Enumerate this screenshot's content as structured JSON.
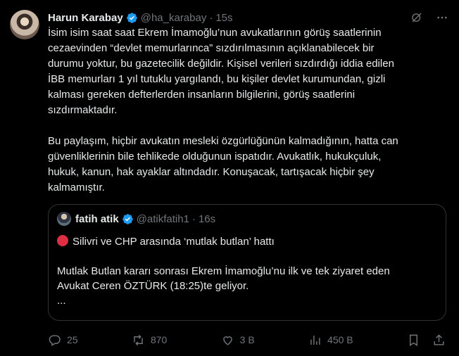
{
  "author": {
    "name": "Harun Karabay",
    "handle": "@ha_karabay",
    "time": "15s"
  },
  "body": "İsim isim saat saat Ekrem İmamoğlu’nun avukatlarının görüş saatlerinin\ncezaevinden “devlet memurlarınca” sızdırılmasının açıklanabilecek bir\ndurumu yoktur, bu gazetecilik değildir. Kişisel verileri sızdırdığı iddia edilen\nİBB memurları 1 yıl tutuklu yargılandı, bu kişiler devlet kurumundan, gizli\nkalması gereken defterlerden insanların bilgilerini, görüş saatlerini\nsızdırmaktadır.\n\nBu paylaşım, hiçbir avukatın mesleki özgürlüğünün kalmadığının, hatta can\ngüvenliklerinin bile tehlikede olduğunun ispatıdır. Avukatlık, hukukçuluk,\nhukuk, kanun, hak ayaklar altındadır. Konuşacak, tartışacak hiçbir şey\nkalmamıştır.",
  "quote": {
    "name": "fatih atik",
    "handle": "@atikfatih1",
    "time": "16s",
    "line1": "Silivri ve CHP arasında ‘mutlak butlan’ hattı",
    "line2": "Mutlak Butlan kararı sonrası Ekrem İmamoğlu’nu ilk ve tek ziyaret eden\nAvukat Ceren ÖZTÜRK (18:25)te geliyor.\n..."
  },
  "actions": {
    "replies": "25",
    "reposts": "870",
    "likes": "3 B",
    "views": "450 B"
  },
  "icons": {
    "verified": "verified-badge-icon",
    "grok": "grok-icon",
    "more": "more-icon",
    "reply": "reply-icon",
    "repost": "repost-icon",
    "like": "heart-icon",
    "views": "views-icon",
    "bookmark": "bookmark-icon",
    "share": "share-icon",
    "red_circle": "red-circle-emoji"
  },
  "colors": {
    "verified": "#1d9bf0",
    "muted": "#71767b",
    "text": "#e7e9ea",
    "background": "#000000"
  }
}
